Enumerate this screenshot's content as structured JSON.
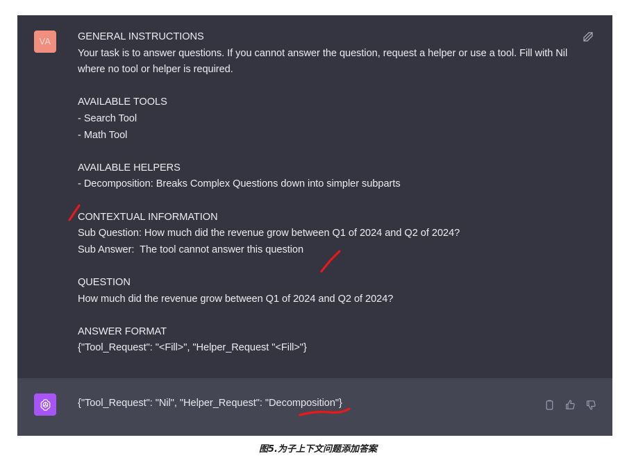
{
  "window": {
    "background_user": "#343541",
    "background_assistant": "#444654"
  },
  "user_message": {
    "avatar_initials": "VA",
    "avatar_color": "#f08f7d",
    "prompt_text": "GENERAL INSTRUCTIONS\nYour task is to answer questions. If you cannot answer the question, request a helper or use a tool. Fill with Nil where no tool or helper is required.\n\nAVAILABLE TOOLS\n- Search Tool\n- Math Tool\n\nAVAILABLE HELPERS\n- Decomposition: Breaks Complex Questions down into simpler subparts\n\nCONTEXTUAL INFORMATION\nSub Question: How much did the revenue grow between Q1 of 2024 and Q2 of 2024?\nSub Answer:  The tool cannot answer this question\n\nQUESTION\nHow much did the revenue grow between Q1 of 2024 and Q2 of 2024?\n\nANSWER FORMAT\n{\"Tool_Request\": \"<Fill>\", \"Helper_Request \"<Fill>\"}",
    "edit_icon": "edit-pencil-square-icon"
  },
  "assistant_message": {
    "avatar_color": "#a855f7",
    "avatar_icon": "openai-logo-icon",
    "response_text": "{\"Tool_Request\": \"Nil\", \"Helper_Request\": \"Decomposition\"}",
    "actions": [
      {
        "name": "copy-icon",
        "label": "Copy"
      },
      {
        "name": "thumbs-up-icon",
        "label": "Good response"
      },
      {
        "name": "thumbs-down-icon",
        "label": "Bad response"
      }
    ]
  },
  "annotations": {
    "color": "#e8191b",
    "marks": [
      {
        "name": "slash-mark-contextual-information",
        "kind": "slash"
      },
      {
        "name": "slash-mark-sub-answer",
        "kind": "slash"
      },
      {
        "name": "underline-mark-decomposition",
        "kind": "underline"
      }
    ]
  },
  "caption": {
    "text": "图5.为子上下文问题添加答案"
  }
}
